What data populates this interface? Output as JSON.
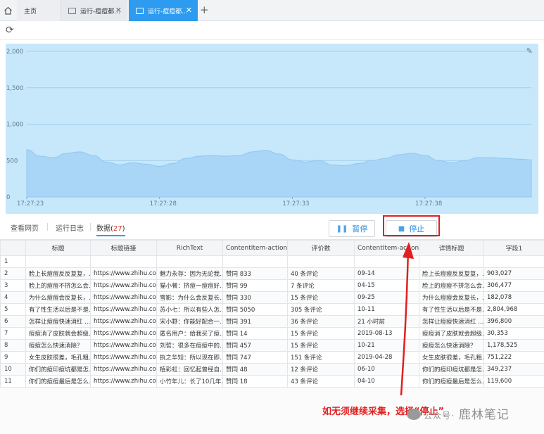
{
  "tabs": {
    "home_label": "主页",
    "items": [
      {
        "label": "运行-痘痘都..."
      },
      {
        "label": "运行-痘痘都..."
      }
    ]
  },
  "chart_data": {
    "type": "area",
    "title": "",
    "xlabel": "",
    "ylabel": "",
    "ylim": [
      0,
      2000
    ],
    "y_ticks": [
      "2,000",
      "1,500",
      "1,000",
      "500",
      "0"
    ],
    "x_ticks": [
      "17:27:23",
      "17:27:28",
      "17:27:33",
      "17:27:38"
    ],
    "x": [
      0,
      0.5,
      1,
      1.5,
      2,
      2.5,
      3,
      3.5,
      4,
      4.5,
      5,
      5.5,
      6,
      6.5,
      7,
      7.5,
      8,
      8.5,
      9,
      9.5,
      10,
      10.5,
      11,
      11.5,
      12,
      12.5,
      13,
      13.5,
      14,
      14.5,
      15,
      15.5,
      16,
      16.5,
      17,
      17.5,
      18,
      18.5,
      19
    ],
    "series": [
      {
        "values": [
          650,
          560,
          540,
          600,
          620,
          570,
          480,
          440,
          470,
          450,
          420,
          460,
          530,
          560,
          570,
          560,
          570,
          620,
          640,
          590,
          510,
          480,
          500,
          440,
          430,
          460,
          500,
          530,
          580,
          600,
          570,
          500,
          470,
          500,
          540,
          540,
          530,
          520,
          510
        ]
      }
    ],
    "grid": true,
    "color": "#a9d6f6"
  },
  "subtabs": {
    "view_page": "查看网页",
    "run_log": "运行日志",
    "data_label": "数据(",
    "data_count": "27",
    "data_close": ")"
  },
  "buttons": {
    "pause": "暂停",
    "stop": "停止"
  },
  "table": {
    "columns": [
      "",
      "标题",
      "标题链接",
      "RichText",
      "ContentItem-actions",
      "评价数",
      "ContentItem-action",
      "详情标题",
      "字段1"
    ],
    "rows": [
      [
        "1",
        "",
        "",
        "",
        "",
        "",
        "",
        "",
        ""
      ],
      [
        "2",
        "脸上长痘痘反反复复，...",
        "https://www.zhihu.com...",
        "魅力永存：因为无论我...",
        "赞同 833",
        "40 条评论",
        "09-14",
        "脸上长痘痘反反复复，...",
        "903,027"
      ],
      [
        "3",
        "脸上的痘痘不挤怎么会...",
        "https://www.zhihu.com...",
        "猫小餐：挤痘一痘痘好...",
        "赞同 99",
        "7 条评论",
        "04-15",
        "脸上的痘痘不挤怎么会...",
        "306,477"
      ],
      [
        "4",
        "为什么痘痘会反复长，...",
        "https://www.zhihu.com...",
        "雪影：为什么会反复长...",
        "赞同 330",
        "15 条评论",
        "09-25",
        "为什么痘痘会反复长，...",
        "182,078"
      ],
      [
        "5",
        "有了性生活以后是不是...",
        "https://www.zhihu.com...",
        "苏小七：所以有些人怎...",
        "赞同 5050",
        "305 条评论",
        "10-11",
        "有了性生活以后是不是...",
        "2,804,968"
      ],
      [
        "6",
        "怎样让痘痘快速消红 ...",
        "https://www.zhihu.com...",
        "宋小野：你能好配合一...",
        "赞同 391",
        "36 条评论",
        "21 小时前",
        "怎样让痘痘快速消红 ...",
        "396,800"
      ],
      [
        "7",
        "痘痘消了皮肤就会超级...",
        "https://www.zhihu.com...",
        "匿名用户：给我买了痘...",
        "赞同 14",
        "15 条评论",
        "2019-08-13",
        "痘痘消了皮肤就会超级...",
        "30,353"
      ],
      [
        "8",
        "痘痘怎么快速消除？",
        "https://www.zhihu.com...",
        "刘哲：很多在痘痘中的...",
        "赞同 457",
        "15 条评论",
        "10-21",
        "痘痘怎么快速消除？",
        "1,178,525"
      ],
      [
        "9",
        "女生皮肤很差，毛孔粗...",
        "https://www.zhihu.com...",
        "执之华知：所以现在即...",
        "赞同 747",
        "151 条评论",
        "2019-04-28",
        "女生皮肤很差，毛孔粗...",
        "751,222"
      ],
      [
        "10",
        "你们的痘印痘坑都是怎...",
        "https://www.zhihu.com...",
        "植彩虹：回忆起曾经自...",
        "赞同 48",
        "12 条评论",
        "06-10",
        "你们的痘印痘坑都是怎...",
        "349,237"
      ],
      [
        "11",
        "你们的痘痘最后是怎么...",
        "https://www.zhihu.com...",
        "小竹年儿：长了10几年...",
        "赞同 18",
        "43 条评论",
        "04-10",
        "你们的痘痘最后是怎么...",
        "119,600"
      ]
    ]
  },
  "annotation": {
    "text": "如无须继续采集，选择“停止”"
  },
  "watermark": {
    "prefix": "公众号·",
    "name": "鹿林笔记"
  }
}
